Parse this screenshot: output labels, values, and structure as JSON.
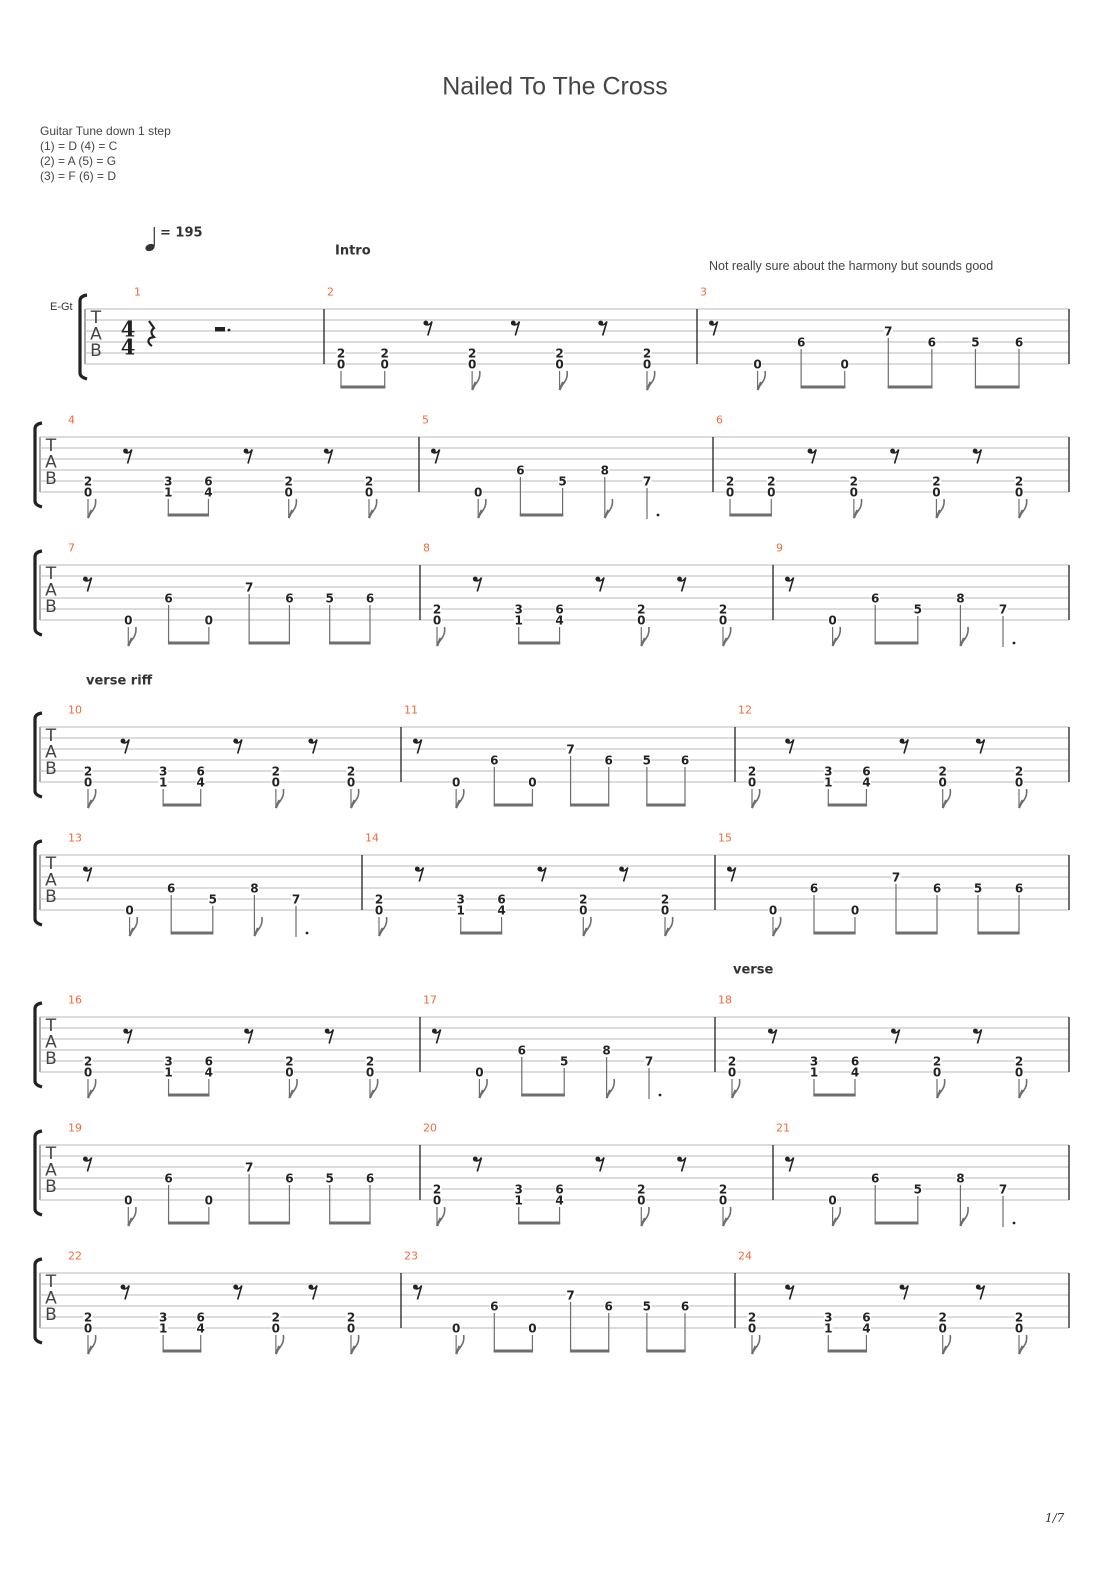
{
  "title": "Nailed To The Cross",
  "tuning": {
    "header": "Guitar Tune down 1 step",
    "lines": [
      "(1) = D (4) = C",
      "(2) = A (5) = G",
      "(3) = F  (6) = D"
    ]
  },
  "tempo": {
    "icon": "quarter-note-icon",
    "label": "= 195",
    "bpm": 195
  },
  "instrument_label": "E-Gt",
  "tab_clef": [
    "T",
    "A",
    "B"
  ],
  "time_signature": {
    "numerator": "4",
    "denominator": "4"
  },
  "sections": [
    {
      "label": "Intro",
      "measure": 2
    },
    {
      "label": "verse riff",
      "measure": 10
    },
    {
      "label": "verse",
      "measure": 18
    }
  ],
  "annotation": {
    "text": "Not really sure about the harmony but sounds good",
    "measure": 3
  },
  "page": "1/7",
  "colors": {
    "measure_number": "#f26b3a",
    "staff_line": "#b8b8b8",
    "bar_line": "#222222",
    "note_text": "#222222",
    "stem_beam": "#6e6e6e"
  },
  "patterns": {
    "M1": {
      "events": [
        {
          "dur": "quarter",
          "rest": true
        },
        {
          "dur": "dotted-half",
          "rest": true
        }
      ]
    },
    "A": {
      "events": [
        {
          "dur": "eighth",
          "beam": "start",
          "notes": [
            {
              "s": 5,
              "f": "2"
            },
            {
              "s": 6,
              "f": "0"
            }
          ]
        },
        {
          "dur": "eighth",
          "beam": "end",
          "notes": [
            {
              "s": 5,
              "f": "2"
            },
            {
              "s": 6,
              "f": "0"
            }
          ]
        },
        {
          "dur": "eighth",
          "rest": true
        },
        {
          "dur": "eighth",
          "notes": [
            {
              "s": 5,
              "f": "2"
            },
            {
              "s": 6,
              "f": "0"
            }
          ]
        },
        {
          "dur": "eighth",
          "rest": true
        },
        {
          "dur": "eighth",
          "notes": [
            {
              "s": 5,
              "f": "2"
            },
            {
              "s": 6,
              "f": "0"
            }
          ]
        },
        {
          "dur": "eighth",
          "rest": true
        },
        {
          "dur": "eighth",
          "notes": [
            {
              "s": 5,
              "f": "2"
            },
            {
              "s": 6,
              "f": "0"
            }
          ]
        }
      ]
    },
    "B": {
      "events": [
        {
          "dur": "eighth",
          "notes": [
            {
              "s": 5,
              "f": "2"
            },
            {
              "s": 6,
              "f": "0"
            }
          ]
        },
        {
          "dur": "eighth",
          "rest": true
        },
        {
          "dur": "eighth",
          "beam": "start",
          "notes": [
            {
              "s": 5,
              "f": "3"
            },
            {
              "s": 6,
              "f": "1"
            }
          ]
        },
        {
          "dur": "eighth",
          "beam": "end",
          "notes": [
            {
              "s": 5,
              "f": "6"
            },
            {
              "s": 6,
              "f": "4"
            }
          ]
        },
        {
          "dur": "eighth",
          "rest": true
        },
        {
          "dur": "eighth",
          "notes": [
            {
              "s": 5,
              "f": "2"
            },
            {
              "s": 6,
              "f": "0"
            }
          ]
        },
        {
          "dur": "eighth",
          "rest": true
        },
        {
          "dur": "eighth",
          "notes": [
            {
              "s": 5,
              "f": "2"
            },
            {
              "s": 6,
              "f": "0"
            }
          ]
        }
      ]
    },
    "C": {
      "events": [
        {
          "dur": "eighth",
          "rest": true
        },
        {
          "dur": "eighth",
          "notes": [
            {
              "s": 6,
              "f": "0"
            }
          ]
        },
        {
          "dur": "eighth",
          "beam": "start",
          "notes": [
            {
              "s": 4,
              "f": "6"
            }
          ]
        },
        {
          "dur": "eighth",
          "beam": "end",
          "notes": [
            {
              "s": 6,
              "f": "0"
            }
          ]
        },
        {
          "dur": "eighth",
          "beam": "start",
          "notes": [
            {
              "s": 3,
              "f": "7"
            }
          ]
        },
        {
          "dur": "eighth",
          "beam": "end",
          "notes": [
            {
              "s": 4,
              "f": "6"
            }
          ]
        },
        {
          "dur": "eighth",
          "beam": "start",
          "notes": [
            {
              "s": 4,
              "f": "5"
            }
          ]
        },
        {
          "dur": "eighth",
          "beam": "end",
          "notes": [
            {
              "s": 4,
              "f": "6"
            }
          ]
        }
      ]
    },
    "D": {
      "events": [
        {
          "dur": "eighth",
          "rest": true
        },
        {
          "dur": "eighth",
          "notes": [
            {
              "s": 6,
              "f": "0"
            }
          ]
        },
        {
          "dur": "eighth",
          "beam": "start",
          "notes": [
            {
              "s": 4,
              "f": "6"
            }
          ]
        },
        {
          "dur": "eighth",
          "beam": "end",
          "notes": [
            {
              "s": 5,
              "f": "5"
            }
          ]
        },
        {
          "dur": "eighth",
          "notes": [
            {
              "s": 4,
              "f": "8"
            }
          ]
        },
        {
          "dur": "dotted-quarter",
          "notes": [
            {
              "s": 5,
              "f": "7"
            }
          ]
        }
      ]
    }
  },
  "measures": [
    {
      "number": "1",
      "pattern": "M1"
    },
    {
      "number": "2",
      "pattern": "A"
    },
    {
      "number": "3",
      "pattern": "C"
    },
    {
      "number": "4",
      "pattern": "B"
    },
    {
      "number": "5",
      "pattern": "D"
    },
    {
      "number": "6",
      "pattern": "A"
    },
    {
      "number": "7",
      "pattern": "C"
    },
    {
      "number": "8",
      "pattern": "B"
    },
    {
      "number": "9",
      "pattern": "D"
    },
    {
      "number": "10",
      "pattern": "B"
    },
    {
      "number": "11",
      "pattern": "C"
    },
    {
      "number": "12",
      "pattern": "B"
    },
    {
      "number": "13",
      "pattern": "D"
    },
    {
      "number": "14",
      "pattern": "B"
    },
    {
      "number": "15",
      "pattern": "C"
    },
    {
      "number": "16",
      "pattern": "B"
    },
    {
      "number": "17",
      "pattern": "D"
    },
    {
      "number": "18",
      "pattern": "B"
    },
    {
      "number": "19",
      "pattern": "C"
    },
    {
      "number": "20",
      "pattern": "B"
    },
    {
      "number": "21",
      "pattern": "D"
    },
    {
      "number": "22",
      "pattern": "B"
    },
    {
      "number": "23",
      "pattern": "C"
    },
    {
      "number": "24",
      "pattern": "B"
    }
  ]
}
